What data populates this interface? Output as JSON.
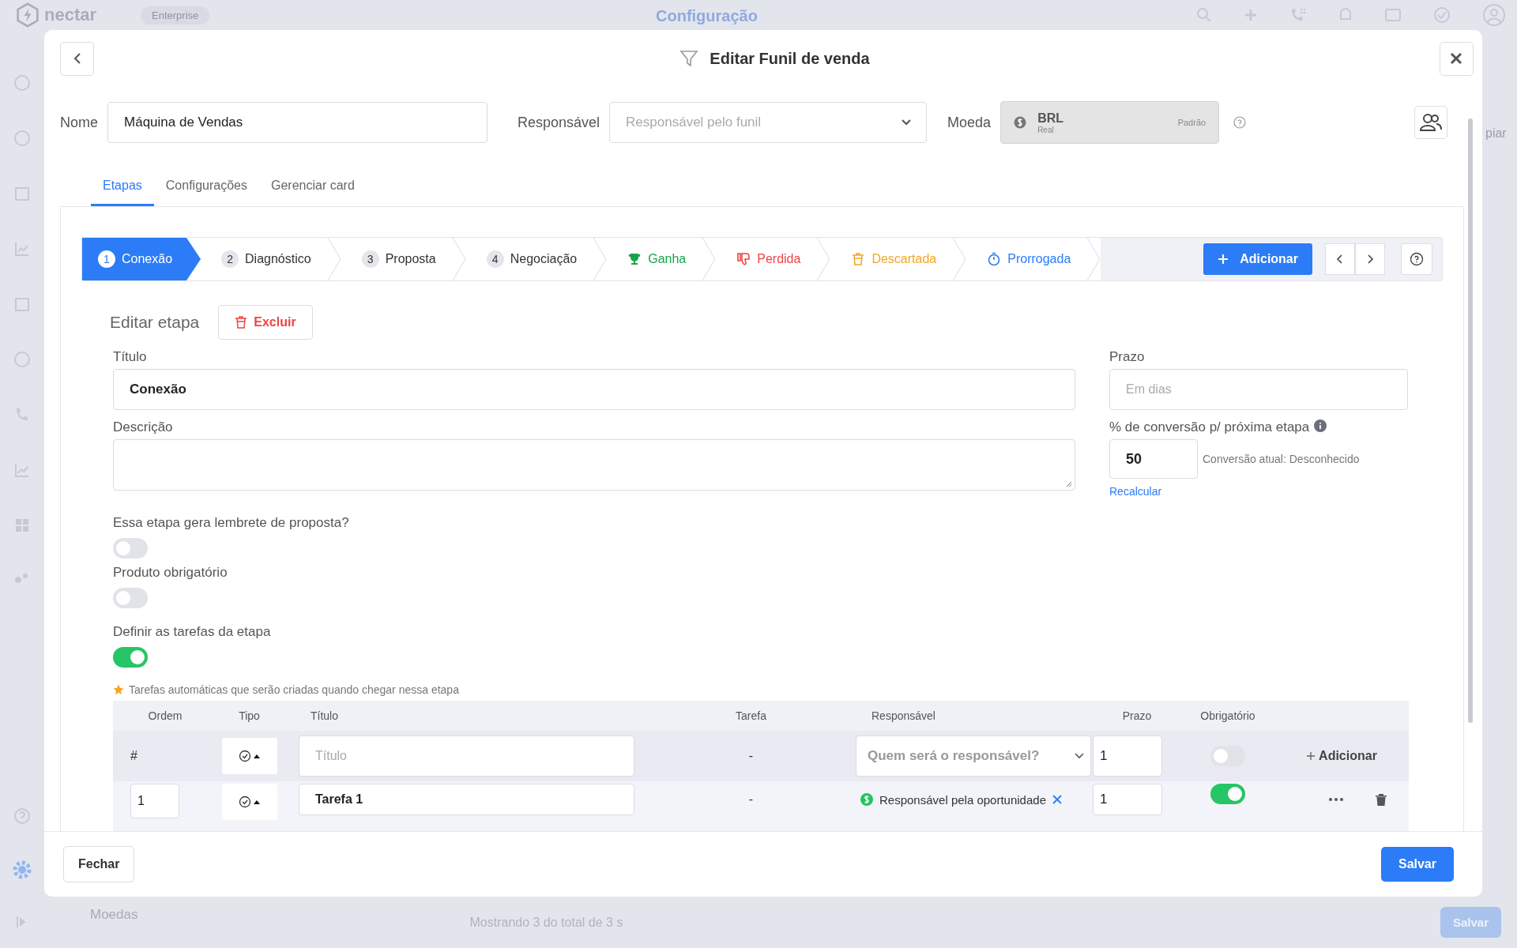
{
  "app": {
    "logo": "nectar",
    "plan": "Enterprise",
    "page_title": "Configuração",
    "side_text": "piar",
    "section": "Moedas",
    "footer_text": "Mostrando 3 do total de 3 s",
    "save_button": "Salvar"
  },
  "modal": {
    "title": "Editar Funil de venda",
    "name": {
      "label": "Nome",
      "value": "Máquina de Vendas"
    },
    "responsible": {
      "label": "Responsável",
      "placeholder": "Responsável pelo funil"
    },
    "currency": {
      "label": "Moeda",
      "code": "BRL",
      "name": "Real",
      "badge": "Padrão"
    },
    "tabs": [
      {
        "label": "Etapas",
        "selected": true
      },
      {
        "label": "Configurações",
        "selected": false
      },
      {
        "label": "Gerenciar card",
        "selected": false
      }
    ],
    "stages": [
      {
        "kind": "numbered",
        "number": "1",
        "label": "Conexão",
        "selected": true
      },
      {
        "kind": "numbered",
        "number": "2",
        "label": "Diagnóstico",
        "selected": false
      },
      {
        "kind": "numbered",
        "number": "3",
        "label": "Proposta",
        "selected": false
      },
      {
        "kind": "numbered",
        "number": "4",
        "label": "Negociação",
        "selected": false
      },
      {
        "kind": "won",
        "label": "Ganha",
        "color": "#17a34a",
        "selected": false
      },
      {
        "kind": "lost",
        "label": "Perdida",
        "color": "#ef4444",
        "selected": false
      },
      {
        "kind": "discarded",
        "label": "Descartada",
        "color": "#f5a623",
        "selected": false
      },
      {
        "kind": "postponed",
        "label": "Prorrogada",
        "color": "#2b7cf6",
        "selected": false
      }
    ],
    "add_stage_button": "Adicionar",
    "edit": {
      "heading": "Editar etapa",
      "delete_button": "Excluir",
      "title_label": "Título",
      "title_value": "Conexão",
      "deadline_label": "Prazo",
      "deadline_placeholder": "Em dias",
      "description_label": "Descrição",
      "conversion_label": "% de conversão p/ próxima etapa",
      "conversion_value": "50",
      "conversion_current": "Conversão atual: Desconhecido",
      "recalc_link": "Recalcular"
    },
    "switches": [
      {
        "label": "Essa etapa gera lembrete de proposta?",
        "on": false
      },
      {
        "label": "Produto obrigatório",
        "on": false
      },
      {
        "label": "Definir as tarefas da etapa",
        "on": true
      }
    ],
    "tasks_note": "Tarefas automáticas que serão criadas quando chegar nessa etapa",
    "table": {
      "columns": [
        "Ordem",
        "Tipo",
        "Título",
        "Tarefa",
        "Responsável",
        "Prazo",
        "Obrigatório"
      ],
      "new_row": {
        "order": "#",
        "title_placeholder": "Título",
        "task": "-",
        "responsible_placeholder": "Quem será o responsável?",
        "deadline": "1",
        "required": false,
        "action": "Adicionar"
      },
      "rows": [
        {
          "order": "1",
          "title": "Tarefa 1",
          "task": "-",
          "responsible": "Responsável pela oportunidade",
          "deadline": "1",
          "required": true
        }
      ]
    },
    "footer": {
      "close_button": "Fechar",
      "save_button": "Salvar"
    }
  }
}
